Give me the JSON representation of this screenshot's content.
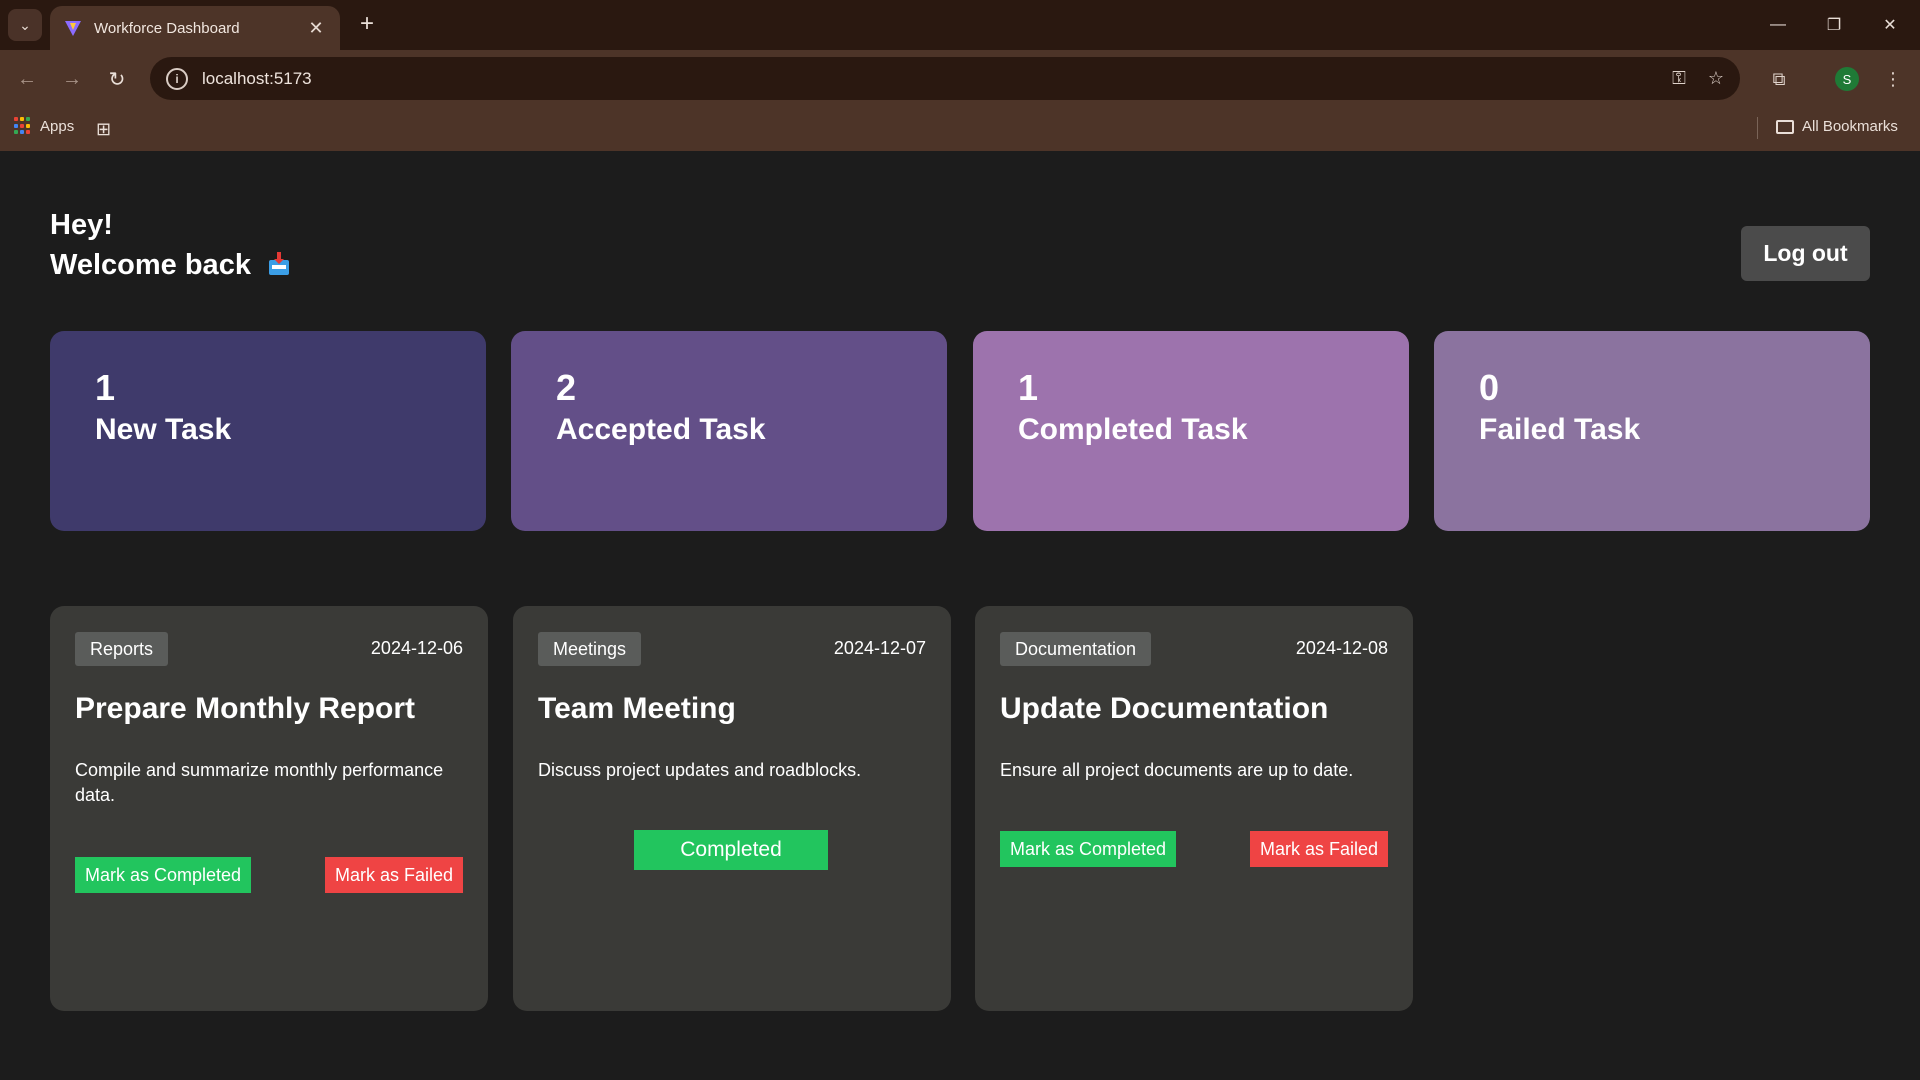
{
  "browser": {
    "tab_title": "Workforce Dashboard",
    "url": "localhost:5173",
    "profile_initial": "S",
    "bookmarks": {
      "apps_label": "Apps",
      "all_bookmarks_label": "All Bookmarks"
    },
    "colors": {
      "tabbar": "#2a1810",
      "toolbar": "#4d3428"
    }
  },
  "header": {
    "greeting": "Hey!",
    "welcome": "Welcome back",
    "welcome_icon": "mailbox-icon",
    "logout_label": "Log out"
  },
  "stats": [
    {
      "count": "1",
      "label": "New Task",
      "color": "#3f3a6b"
    },
    {
      "count": "2",
      "label": "Accepted Task",
      "color": "#634f88"
    },
    {
      "count": "1",
      "label": "Completed Task",
      "color": "#9d73ad"
    },
    {
      "count": "0",
      "label": "Failed Task",
      "color": "#8b739f"
    }
  ],
  "tasks": [
    {
      "category": "Reports",
      "date": "2024-12-06",
      "title": "Prepare Monthly Report",
      "description": "Compile and summarize monthly performance data.",
      "complete_label": "Mark as Completed",
      "fail_label": "Mark as Failed"
    },
    {
      "category": "Meetings",
      "date": "2024-12-07",
      "title": "Team Meeting",
      "description": "Discuss project updates and roadblocks.",
      "status_label": "Completed"
    },
    {
      "category": "Documentation",
      "date": "2024-12-08",
      "title": "Update Documentation",
      "description": "Ensure all project documents are up to date.",
      "complete_label": "Mark as Completed",
      "fail_label": "Mark as Failed"
    }
  ],
  "colors": {
    "complete_green": "#22c55e",
    "fail_red": "#ef4444",
    "card_bg": "#3a3a37",
    "page_bg": "#1c1c1c"
  }
}
